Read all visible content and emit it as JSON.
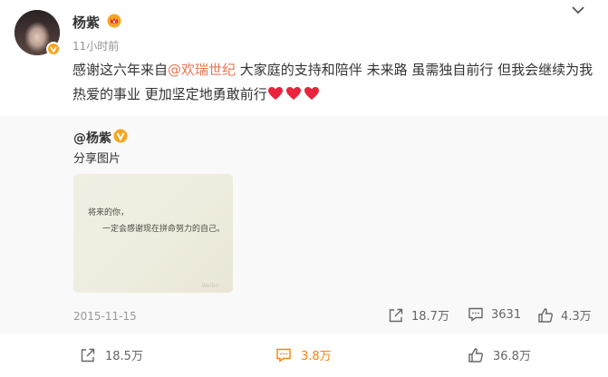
{
  "post": {
    "username": "杨紫",
    "time": "11小时前",
    "text_before": "感谢这六年来自",
    "mention": "@欢瑞世纪",
    "text_after": " 大家庭的支持和陪伴 未来路 虽需独自前行 但我会继续为我热爱的事业 更加坚定地勇敢前行",
    "heart_count": 3,
    "colors": {
      "mention": "#eb7350",
      "heart": "#e8233b",
      "badge": "#f6a623",
      "accent": "#ff8200"
    },
    "icons": [
      "avatar",
      "verified-badge-icon",
      "vip-crown-icon",
      "chevron-down-icon",
      "heart-icon"
    ]
  },
  "repost": {
    "user": "@杨紫",
    "text": "分享图片",
    "image_line1": "将来的你，",
    "image_line2": "一定会感谢现在拼命努力的自己。",
    "image_watermark": "Weibo",
    "date": "2015-11-15",
    "shares": "18.7万",
    "comments": "3631",
    "likes": "4.3万"
  },
  "actions": {
    "shares": "18.5万",
    "comments": "3.8万",
    "likes": "36.8万"
  }
}
